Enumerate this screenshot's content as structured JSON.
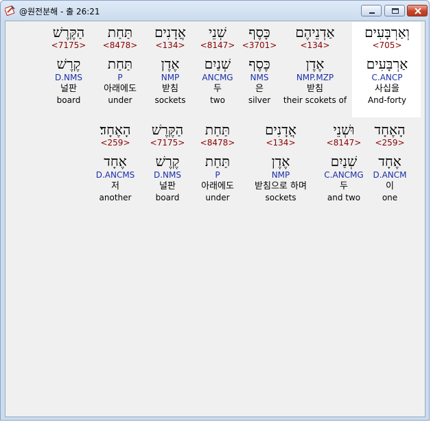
{
  "window": {
    "title": "@원전분해 - 출 26:21"
  },
  "rows": [
    {
      "words": [
        {
          "hebrew": "וְאַרְבָּעִים",
          "strong": "<705>",
          "lemma": "אַרְבָּעִים",
          "morph": "C.ANCP",
          "korean": "사십을",
          "english": "And-forty",
          "highlight": true
        },
        {
          "hebrew": "אַדְנֵיהֶם",
          "strong": "<134>",
          "lemma": "אֶדֶן",
          "morph": "NMP.MZP",
          "korean": "받침",
          "english": "their scokets of"
        },
        {
          "hebrew": "כָּסֶף",
          "strong": "<3701>",
          "lemma": "כֶּסֶף",
          "morph": "NMS",
          "korean": "은",
          "english": "silver"
        },
        {
          "hebrew": "שְׁנֵי",
          "strong": "<8147>",
          "lemma": "שְׁנַיִם",
          "morph": "ANCMG",
          "korean": "두",
          "english": "two"
        },
        {
          "hebrew": "אֲדָנִים",
          "strong": "<134>",
          "lemma": "אֶדֶן",
          "morph": "NMP",
          "korean": "받침",
          "english": "sockets"
        },
        {
          "hebrew": "תַּחַת",
          "strong": "<8478>",
          "lemma": "תַּחַת",
          "morph": "P",
          "korean": "아래에도",
          "english": "under"
        },
        {
          "hebrew": "הַקֶּרֶשׁ",
          "strong": "<7175>",
          "lemma": "קֶרֶשׁ",
          "morph": "D.NMS",
          "korean": "널판",
          "english": "board"
        }
      ]
    },
    {
      "words": [
        {
          "hebrew": "הָאֶחָד",
          "strong": "<259>",
          "lemma": "אֶחָד",
          "morph": "D.ANCM",
          "korean": "이",
          "english": "one"
        },
        {
          "hebrew": "וּשְׁנֵי",
          "strong": "<8147>",
          "lemma": "שְׁנַיִם",
          "morph": "C.ANCMG",
          "korean": "두",
          "english": "and two"
        },
        {
          "hebrew": "אֲדָנִים",
          "strong": "<134>",
          "lemma": "אֶדֶן",
          "morph": "NMP",
          "korean": "받침으로 하며",
          "english": "sockets"
        },
        {
          "hebrew": "תַּחַת",
          "strong": "<8478>",
          "lemma": "תַּחַת",
          "morph": "P",
          "korean": "아래에도",
          "english": "under"
        },
        {
          "hebrew": "הַקֶּרֶשׁ",
          "strong": "<7175>",
          "lemma": "קֶרֶשׁ",
          "morph": "D.NMS",
          "korean": "널판",
          "english": "board"
        },
        {
          "hebrew": "הָאֶחָד׃",
          "strong": "<259>",
          "lemma": "אֶחָד",
          "morph": "D.ANCMS",
          "korean": "저",
          "english": "another"
        }
      ]
    }
  ],
  "colors": {
    "strong": "#8b0000",
    "morph": "#1a2fa8",
    "highlight_bg": "#ffffff",
    "client_bg": "#f0f0f0"
  },
  "icons": [
    "app-icon",
    "minimize-icon",
    "maximize-icon",
    "close-icon"
  ]
}
